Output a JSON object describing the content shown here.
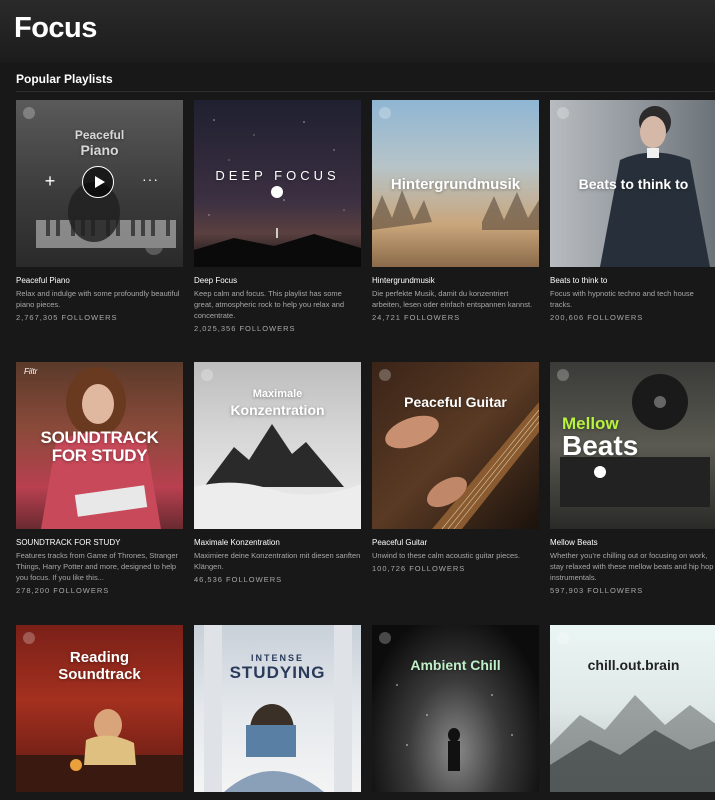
{
  "page": {
    "title": "Focus"
  },
  "section": {
    "title": "Popular Playlists"
  },
  "icons": {
    "play": "play-icon",
    "add": "plus-icon",
    "more": "more-options-icon",
    "spotify": "spotify-logo-icon"
  },
  "controls": {
    "add_glyph": "+",
    "more_glyph": "···"
  },
  "playlists": [
    {
      "title": "Peaceful Piano",
      "description": "Relax and indulge with some profoundly beautiful piano pieces.",
      "followers": "2,767,305 FOLLOWERS",
      "cover_line1": "Peaceful",
      "cover_line2": "Piano"
    },
    {
      "title": "Deep Focus",
      "description": "Keep calm and focus. This playlist has some great, atmospheric rock to help you relax and concentrate.",
      "followers": "2,025,356 FOLLOWERS",
      "cover_line1": "DEEP FOCUS"
    },
    {
      "title": "Hintergrundmusik",
      "description": "Die perfekte Musik, damit du konzentriert arbeiten, lesen oder einfach entspannen kannst.",
      "followers": "24,721 FOLLOWERS",
      "cover_line1": "Hintergrundmusik"
    },
    {
      "title": "Beats to think to",
      "description": "Focus with hypnotic techno and tech house tracks.",
      "followers": "200,606 FOLLOWERS",
      "cover_line1": "Beats to think to"
    },
    {
      "title": "SOUNDTRACK FOR STUDY",
      "description": "Features tracks from Game of Thrones, Stranger Things, Harry Potter and more, designed to help you focus. If you like this...",
      "followers": "278,200 FOLLOWERS",
      "cover_line1": "SOUNDTRACK",
      "cover_line2": "FOR STUDY",
      "cover_mark": "Filtr"
    },
    {
      "title": "Maximale Konzentration",
      "description": "Maximiere deine Konzentration mit diesen sanften Klängen.",
      "followers": "46,536 FOLLOWERS",
      "cover_line1": "Maximale",
      "cover_line2": "Konzentration"
    },
    {
      "title": "Peaceful Guitar",
      "description": "Unwind to these calm acoustic guitar pieces.",
      "followers": "100,726 FOLLOWERS",
      "cover_line1": "Peaceful Guitar"
    },
    {
      "title": "Mellow Beats",
      "description": "Whether you're chilling out or focusing on work, stay relaxed with these mellow beats and hip hop instrumentals.",
      "followers": "597,903 FOLLOWERS",
      "cover_line1": "Mellow",
      "cover_line2": "Beats"
    },
    {
      "title": "",
      "description": "",
      "followers": "",
      "cover_line1": "Reading",
      "cover_line2": "Soundtrack"
    },
    {
      "title": "",
      "description": "",
      "followers": "",
      "cover_line1": "INTENSE",
      "cover_line2": "STUDYING"
    },
    {
      "title": "",
      "description": "",
      "followers": "",
      "cover_line1": "Ambient Chill"
    },
    {
      "title": "",
      "description": "",
      "followers": "",
      "cover_line1": "chill.out.brain"
    }
  ]
}
